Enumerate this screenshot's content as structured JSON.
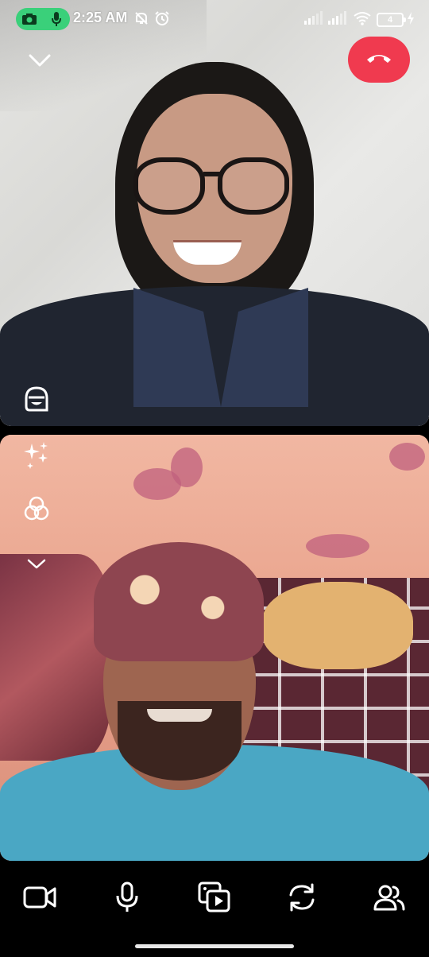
{
  "status_bar": {
    "time": "2:25 AM",
    "battery_level": "4",
    "icons": [
      "camera-icon",
      "mic-icon",
      "muted-notifications-icon",
      "alarm-icon",
      "signal-icon",
      "signal-icon",
      "wifi-icon",
      "battery-icon",
      "charging-icon"
    ]
  },
  "call": {
    "minimize_icon": "chevron-down-icon",
    "end_call_icon": "phone-hangup-icon",
    "end_call_color": "#f03a4f",
    "remote_overlay_icon": "bitmoji-face-icon",
    "local_tools": [
      "sparkle-effects-icon",
      "filters-icon",
      "chevron-down-icon"
    ]
  },
  "toolbar": {
    "items": [
      "video-camera-icon",
      "microphone-icon",
      "media-share-icon",
      "switch-camera-icon",
      "participants-icon"
    ]
  },
  "colors": {
    "recording_indicator": "#3ad07a",
    "background": "#000000"
  }
}
